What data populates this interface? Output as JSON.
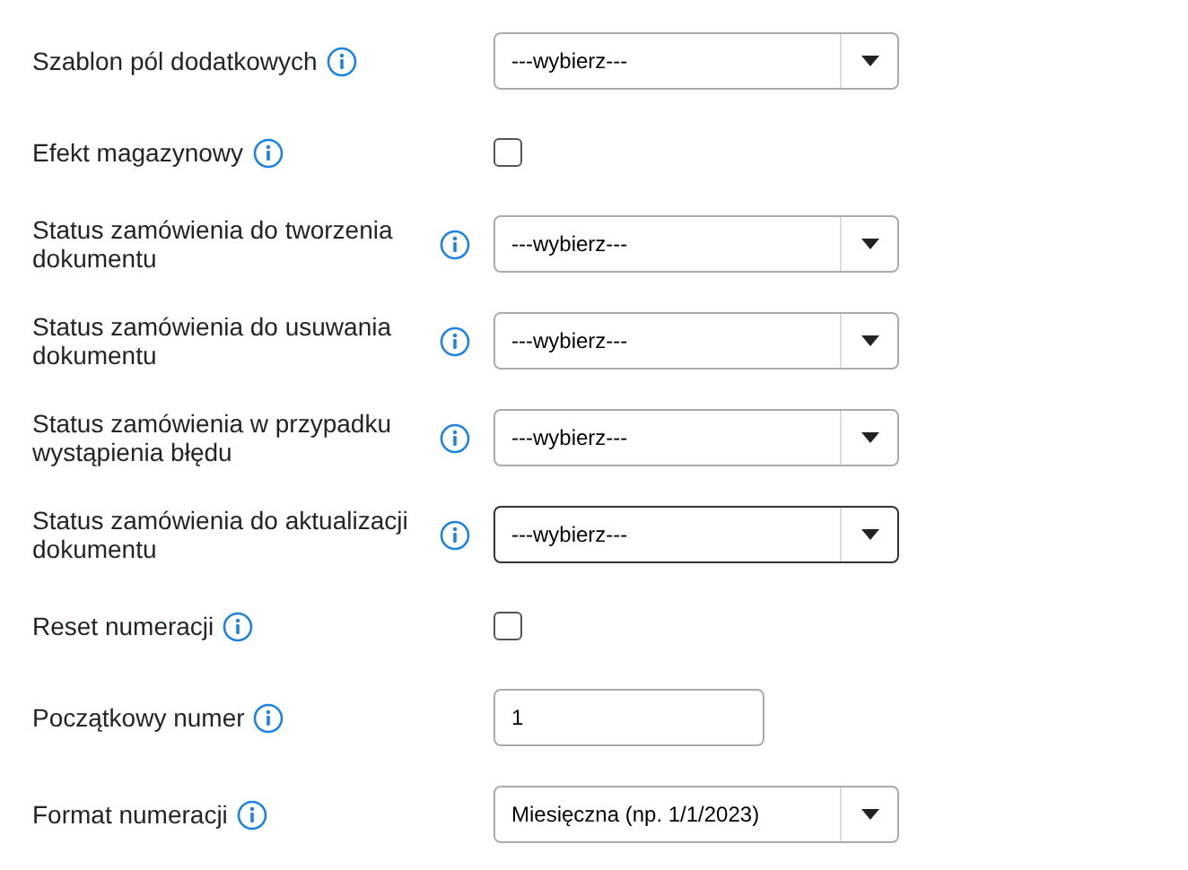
{
  "fields": [
    {
      "label": "Szablon pól dodatkowych",
      "kind": "select",
      "value": "---wybierz---",
      "focused": false
    },
    {
      "label": "Efekt magazynowy",
      "kind": "checkbox",
      "checked": false
    },
    {
      "label": "Status zamówienia do tworzenia dokumentu",
      "kind": "select",
      "value": "---wybierz---",
      "focused": false
    },
    {
      "label": "Status zamówienia do usuwania dokumentu",
      "kind": "select",
      "value": "---wybierz---",
      "focused": false
    },
    {
      "label": "Status zamówienia w przypadku wystąpienia błędu",
      "kind": "select",
      "value": "---wybierz---",
      "focused": false
    },
    {
      "label": "Status zamówienia do aktualizacji dokumentu",
      "kind": "select",
      "value": "---wybierz---",
      "focused": true
    },
    {
      "label": "Reset numeracji",
      "kind": "checkbox",
      "checked": false
    },
    {
      "label": "Początkowy numer",
      "kind": "text",
      "value": "1"
    },
    {
      "label": "Format numeracji",
      "kind": "select",
      "value": "Miesięczna (np. 1/1/2023)",
      "focused": false
    }
  ]
}
